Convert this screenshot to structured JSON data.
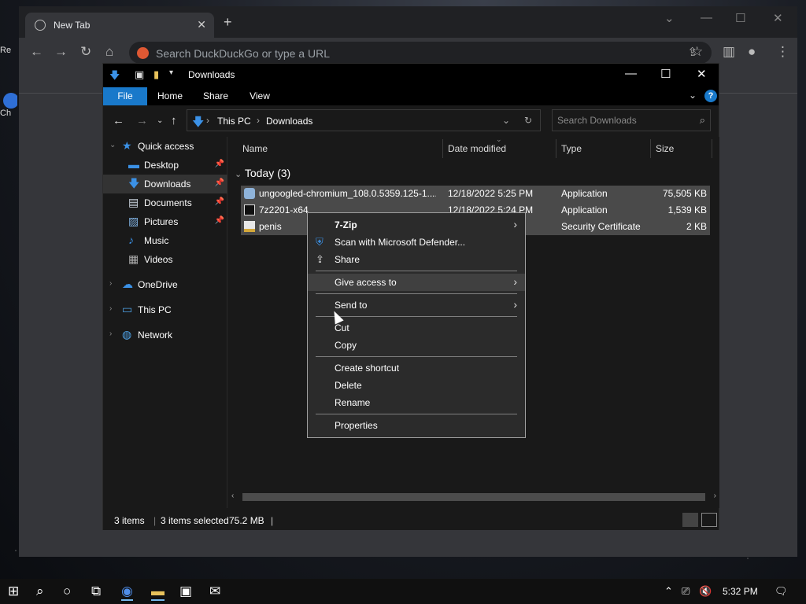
{
  "desktop": {
    "icons": [
      {
        "label": "Re"
      },
      {
        "label": "Ch"
      }
    ]
  },
  "browser": {
    "tab_title": "New Tab",
    "address_placeholder": "Search DuckDuckGo or type a URL"
  },
  "explorer": {
    "title": "Downloads",
    "ribbon_tabs": [
      "File",
      "Home",
      "Share",
      "View"
    ],
    "breadcrumb": [
      "This PC",
      "Downloads"
    ],
    "search_placeholder": "Search Downloads",
    "nav_items": [
      {
        "label": "Quick access",
        "icon": "star-icon"
      },
      {
        "label": "Desktop",
        "icon": "desktop-folder-icon",
        "pinned": true
      },
      {
        "label": "Downloads",
        "icon": "downloads-folder-icon",
        "pinned": true,
        "selected": true
      },
      {
        "label": "Documents",
        "icon": "documents-folder-icon",
        "pinned": true
      },
      {
        "label": "Pictures",
        "icon": "pictures-folder-icon",
        "pinned": true
      },
      {
        "label": "Music",
        "icon": "music-folder-icon"
      },
      {
        "label": "Videos",
        "icon": "videos-folder-icon"
      },
      {
        "label": "OneDrive",
        "icon": "cloud-icon"
      },
      {
        "label": "This PC",
        "icon": "computer-icon"
      },
      {
        "label": "Network",
        "icon": "network-icon"
      }
    ],
    "columns": [
      "Name",
      "Date modified",
      "Type",
      "Size"
    ],
    "group_label": "Today (3)",
    "files": [
      {
        "name": "ungoogled-chromium_108.0.5359.125-1....",
        "date": "12/18/2022 5:25 PM",
        "type": "Application",
        "size": "75,505 KB"
      },
      {
        "name": "7z2201-x64",
        "date": "12/18/2022 5:24 PM",
        "type": "Application",
        "size": "1,539 KB"
      },
      {
        "name": "penis",
        "date": "",
        "type": "Security Certificate",
        "size": "2 KB"
      }
    ],
    "status": {
      "items": "3 items",
      "selected": "3 items selected",
      "size": "75.2 MB"
    }
  },
  "context_menu": {
    "items": [
      {
        "label": "7-Zip",
        "submenu": true
      },
      {
        "label": "Scan with Microsoft Defender...",
        "icon": "defender-shield-icon"
      },
      {
        "label": "Share",
        "icon": "share-icon"
      },
      {
        "label": "Give access to",
        "submenu": true
      },
      {
        "label": "Send to",
        "submenu": true
      },
      {
        "label": "Cut"
      },
      {
        "label": "Copy"
      },
      {
        "label": "Create shortcut"
      },
      {
        "label": "Delete"
      },
      {
        "label": "Rename"
      },
      {
        "label": "Properties"
      }
    ]
  },
  "taskbar": {
    "clock": "5:32 PM"
  },
  "colors": {
    "accent": "#1979ca",
    "selection": "#4a4a4a",
    "menu_bg": "#2b2b2b"
  }
}
